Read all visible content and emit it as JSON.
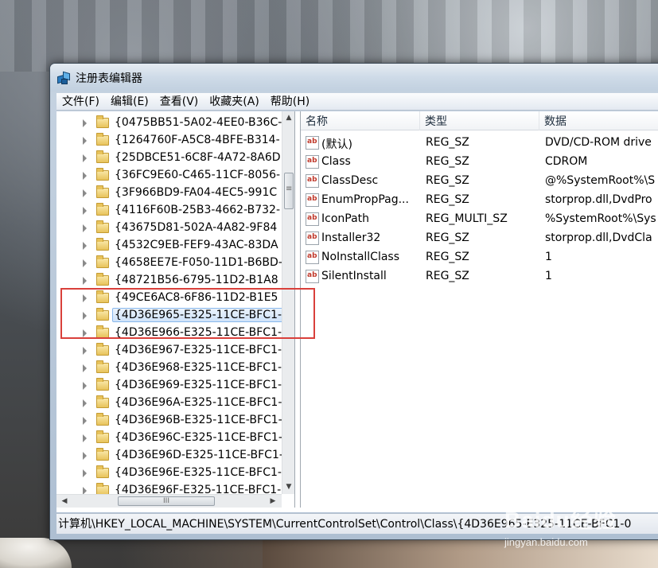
{
  "window": {
    "title": "注册表编辑器"
  },
  "menubar": {
    "items": [
      "文件(F)",
      "编辑(E)",
      "查看(V)",
      "收藏夹(A)",
      "帮助(H)"
    ]
  },
  "tree": {
    "items": [
      {
        "label": "{0475BB51-5A02-4EE0-B36C-"
      },
      {
        "label": "{1264760F-A5C8-4BFE-B314-"
      },
      {
        "label": "{25DBCE51-6C8F-4A72-8A6D"
      },
      {
        "label": "{36FC9E60-C465-11CF-8056-"
      },
      {
        "label": "{3F966BD9-FA04-4EC5-991C"
      },
      {
        "label": "{4116F60B-25B3-4662-B732-"
      },
      {
        "label": "{43675D81-502A-4A82-9F84"
      },
      {
        "label": "{4532C9EB-FEF9-43AC-83DA"
      },
      {
        "label": "{4658EE7E-F050-11D1-B6BD-"
      },
      {
        "label": "{48721B56-6795-11D2-B1A8"
      },
      {
        "label": "{49CE6AC8-6F86-11D2-B1E5"
      },
      {
        "label": "{4D36E965-E325-11CE-BFC1-",
        "selected": true
      },
      {
        "label": "{4D36E966-E325-11CE-BFC1-"
      },
      {
        "label": "{4D36E967-E325-11CE-BFC1-"
      },
      {
        "label": "{4D36E968-E325-11CE-BFC1-"
      },
      {
        "label": "{4D36E969-E325-11CE-BFC1-"
      },
      {
        "label": "{4D36E96A-E325-11CE-BFC1-"
      },
      {
        "label": "{4D36E96B-E325-11CE-BFC1-"
      },
      {
        "label": "{4D36E96C-E325-11CE-BFC1-"
      },
      {
        "label": "{4D36E96D-E325-11CE-BFC1-"
      },
      {
        "label": "{4D36E96E-E325-11CE-BFC1-"
      },
      {
        "label": "{4D36E96F-E325-11CE-BFC1-"
      }
    ],
    "scroll_thumb_label": "III"
  },
  "list": {
    "columns": {
      "name": "名称",
      "type": "类型",
      "data": "数据"
    },
    "rows": [
      {
        "name": "(默认)",
        "type": "REG_SZ",
        "data": "DVD/CD-ROM drive"
      },
      {
        "name": "Class",
        "type": "REG_SZ",
        "data": "CDROM"
      },
      {
        "name": "ClassDesc",
        "type": "REG_SZ",
        "data": "@%SystemRoot%\\S"
      },
      {
        "name": "EnumPropPag...",
        "type": "REG_SZ",
        "data": "storprop.dll,DvdPro"
      },
      {
        "name": "IconPath",
        "type": "REG_MULTI_SZ",
        "data": "%SystemRoot%\\Sys"
      },
      {
        "name": "Installer32",
        "type": "REG_SZ",
        "data": "storprop.dll,DvdCla"
      },
      {
        "name": "NoInstallClass",
        "type": "REG_SZ",
        "data": "1"
      },
      {
        "name": "SilentInstall",
        "type": "REG_SZ",
        "data": "1"
      }
    ],
    "value_icon_text": "ab"
  },
  "statusbar": {
    "path": "计算机\\HKEY_LOCAL_MACHINE\\SYSTEM\\CurrentControlSet\\Control\\Class\\{4D36E965-E325-11CE-BFC1-0"
  },
  "watermark": {
    "logo": "Baidu经验",
    "url": "jingyan.baidu.com"
  },
  "colors": {
    "annotation_box": "#d9403b",
    "selection": "#cfe3f9"
  }
}
